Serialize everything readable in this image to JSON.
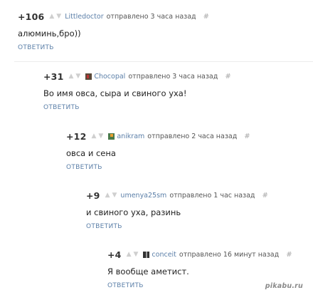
{
  "comments": [
    {
      "score": "+106",
      "author": "Littledoctor",
      "sent": "отправлено 3 часа назад",
      "hash": "#",
      "text": "алюминь,бро))",
      "reply": "ответить",
      "flag_icon": null
    },
    {
      "score": "+31",
      "author": "Chocopal",
      "sent": "отправлено 3 часа назад",
      "hash": "#",
      "text": "Во имя овса, сыра и свиного уха!",
      "reply": "ответить",
      "flag_icon": "user-flag-icon"
    },
    {
      "score": "+12",
      "author": "anikram",
      "sent": "отправлено 2 часа назад",
      "hash": "#",
      "text": "овса и сена",
      "reply": "ответить",
      "flag_icon": "user-flag-icon"
    },
    {
      "score": "+9",
      "author": "umenya25sm",
      "sent": "отправлено 1 час назад",
      "hash": "#",
      "text": "и свиного уха, разинь",
      "reply": "ответить",
      "flag_icon": null
    },
    {
      "score": "+4",
      "author": "conceit",
      "sent": "отправлено 16 минут назад",
      "hash": "#",
      "text": "Я вообще аметист.",
      "reply": "ответить",
      "flag_icon": "user-flag-icon"
    }
  ],
  "vote_icons": {
    "up": "upvote-arrow-icon",
    "down": "downvote-arrow-icon"
  },
  "watermark": "pikabu.ru",
  "colors": {
    "link": "#5b7fa8",
    "vote_arrows": "#cfcfcf",
    "score": "#333333"
  }
}
